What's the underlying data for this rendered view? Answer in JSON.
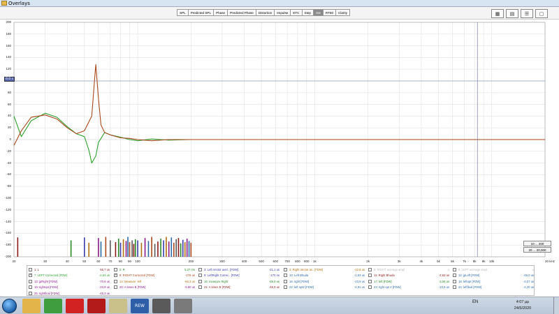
{
  "window": {
    "title": "Overlays"
  },
  "toolbar": {
    "tabs": [
      "SPL",
      "Predicted SPL",
      "Phase",
      "Predicted Phase",
      "Distortion",
      "Impulse",
      "ETC",
      "Step",
      "GD",
      "RT60",
      "Clarity"
    ],
    "active_tab": "GD",
    "window_controls": [
      "overlay-grid-icon",
      "overlay-list-icon",
      "overlay-stack-icon",
      "overlay-fill-icon"
    ]
  },
  "graph": {
    "y_ticks": [
      "200",
      "180",
      "160",
      "140",
      "120",
      "100",
      "80",
      "60",
      "40",
      "20",
      "0",
      "-20",
      "-40",
      "-60",
      "-80",
      "-100",
      "-120",
      "-140",
      "-160",
      "-180",
      "-200"
    ],
    "x_ticks": [
      "20",
      "30",
      "40",
      "50",
      "60",
      "70",
      "80",
      "90",
      "100",
      "200",
      "300",
      "400",
      "500",
      "600",
      "700",
      "800",
      "900",
      "1k",
      "2k",
      "3k",
      "4k",
      "5k",
      "6k",
      "7k",
      "8k",
      "9k",
      "10k",
      "20 kHz"
    ],
    "ref_badge": "0.0 s",
    "range_buttons": [
      "10 ... 200",
      "20 ... 20,000"
    ],
    "colors": {
      "green": "#2ea12e",
      "brown": "#a8481c",
      "grid": "#e2e2e2"
    }
  },
  "chart_data": {
    "type": "line",
    "xlabel": "",
    "ylabel": "",
    "xscale": "log",
    "xlim": [
      20,
      20000
    ],
    "ylim": [
      -200,
      200
    ],
    "series": [
      {
        "name": "7: LEFT Corrected [FDW]",
        "color": "#2ea12e",
        "x": [
          20,
          22,
          25,
          30,
          35,
          40,
          45,
          50,
          53,
          55,
          58,
          60,
          65,
          70,
          80,
          90,
          100,
          120,
          150,
          200,
          300,
          500,
          1000,
          20000
        ],
        "y": [
          40,
          5,
          32,
          45,
          38,
          22,
          10,
          5,
          -18,
          -40,
          -28,
          -5,
          12,
          8,
          4,
          0,
          -2,
          1,
          -1,
          0,
          0,
          0,
          0,
          0
        ]
      },
      {
        "name": "8: RIGHT Corrected [FDW]",
        "color": "#a8481c",
        "x": [
          20,
          22,
          25,
          30,
          35,
          40,
          45,
          50,
          55,
          57,
          58,
          60,
          62,
          65,
          70,
          80,
          90,
          100,
          120,
          150,
          200,
          300,
          500,
          1000,
          20000
        ],
        "y": [
          -10,
          15,
          38,
          42,
          35,
          20,
          10,
          15,
          40,
          100,
          128,
          70,
          25,
          12,
          8,
          3,
          2,
          0,
          -2,
          0,
          0,
          0,
          0,
          0,
          0
        ]
      }
    ],
    "bars": {
      "x": [
        21,
        42,
        50,
        53,
        60,
        62,
        66,
        70,
        75,
        78,
        80,
        83,
        86,
        88,
        90,
        93,
        95,
        97,
        100,
        105,
        110,
        115,
        120,
        125,
        130,
        135,
        140,
        145,
        150,
        155,
        160,
        165,
        170,
        175,
        180,
        185,
        190,
        195,
        200
      ],
      "y": [
        -167,
        -172,
        -167,
        -176,
        -168,
        -174,
        -166,
        -172,
        -175,
        -169,
        -176,
        -170,
        -173,
        -166,
        -175,
        -172,
        -178,
        -170,
        -172,
        -176,
        -168,
        -173,
        -166,
        -178,
        -174,
        -169,
        -172,
        -166,
        -174,
        -167,
        -176,
        -170,
        -168,
        -177,
        -171,
        -175,
        -169,
        -173,
        -176
      ]
    }
  },
  "legend": {
    "rows": [
      [
        {
          "name": "1: L",
          "value": "66,7 us",
          "color": "#8a1a1a",
          "checked": false
        },
        {
          "name": "2: R",
          "value": "5,27 ms",
          "color": "#2a8a2a",
          "checked": false
        },
        {
          "name": "3: Left Vector aver.. [FDW]",
          "value": "-21,1 us",
          "color": "#3a3aa8",
          "checked": false
        },
        {
          "name": "4: Right Vector av.. [FDW]",
          "value": "-12,8 us",
          "color": "#b07010",
          "checked": false
        },
        {
          "name": "5: RIGHT average ampl",
          "value": "u",
          "color": "#bbbbbb",
          "checked": false
        },
        {
          "name": "6: LEFT average ampl",
          "value": "u",
          "color": "#bbbbbb",
          "checked": false
        }
      ],
      [
        {
          "name": "7: LEFT Corrected [FDW]",
          "value": "-2,64 us",
          "color": "#2ea12e",
          "checked": true
        },
        {
          "name": "8: RIGHT Corrected [FDW]",
          "value": "-276 us",
          "color": "#a8481c",
          "checked": true
        },
        {
          "name": "9: LeftRight Correc.. [FDW]",
          "value": "-170 ns",
          "color": "#3a3aa8",
          "checked": false
        },
        {
          "name": "10: Left Bhuda",
          "value": "-2,63 us",
          "color": "#2a6aa8",
          "checked": false
        },
        {
          "name": "11: Right Bhuda",
          "value": "-2,63 us",
          "color": "#8a1a1a",
          "checked": false
        },
        {
          "name": "12: jpLeft [FDW]",
          "value": "-49,0 us",
          "color": "#2a6aa8",
          "checked": false
        }
      ],
      [
        {
          "name": "13: jpRight [FDW]",
          "value": "-70,6 us",
          "color": "#8a1a8a",
          "checked": false
        },
        {
          "name": "14: Measure: left",
          "value": "-60,3 us",
          "color": "#b07010",
          "checked": false
        },
        {
          "name": "15: measure Right",
          "value": "-69,9 us",
          "color": "#2a8a2a",
          "checked": false
        },
        {
          "name": "16: right [FDW]",
          "value": "-23,9 us",
          "color": "#2a6aa8",
          "checked": false
        },
        {
          "name": "17: left [FDW]",
          "value": "-3,06 us",
          "color": "#2a8a2a",
          "checked": false
        },
        {
          "name": "18: leftopt [FDW]",
          "value": "-3,07 us",
          "color": "#2a6aa8",
          "checked": false
        }
      ],
      [
        {
          "name": "19: rightopt [FDW]",
          "value": "-23,9 us",
          "color": "#8a1a8a",
          "checked": false
        },
        {
          "name": "20: A times B [FDW]",
          "value": "-9,80 us",
          "color": "#8a1a8a",
          "checked": false
        },
        {
          "name": "21: A times B [FDW]",
          "value": "-46,9 us",
          "color": "#8a1a1a",
          "checked": false
        },
        {
          "name": "22: left opt2 [FDW]",
          "value": "-4,91 us",
          "color": "#2a6aa8",
          "checked": false
        },
        {
          "name": "23: right opt 2 [FDW]",
          "value": "-23,9 us",
          "color": "#2a6aa8",
          "checked": false
        },
        {
          "name": "24: leftfinal [FDW]",
          "value": "-3,20 us",
          "color": "#2a6aa8",
          "checked": false
        }
      ],
      [
        {
          "name": "25: rightfinal [FDW]",
          "value": "-45,3 us",
          "color": "#8a1a8a",
          "checked": false
        }
      ]
    ]
  },
  "taskbar": {
    "apps": [
      {
        "name": "explorer-icon",
        "color": "#e3b449"
      },
      {
        "name": "chrome-icon",
        "color": "#3f9d40"
      },
      {
        "name": "opera-icon",
        "color": "#d22222"
      },
      {
        "name": "dice-game-icon",
        "color": "#b31b1b"
      },
      {
        "name": "notepad-icon",
        "color": "#c9c08a"
      },
      {
        "name": "rew-icon",
        "color": "#2d5fa8"
      },
      {
        "name": "alien-app-icon",
        "color": "#5a5a5a"
      },
      {
        "name": "sketch-app-icon",
        "color": "#7a7a7a"
      }
    ],
    "rew_label": "REW",
    "language": "EN",
    "time": "4:07 μμ",
    "date": "24/5/2020"
  }
}
